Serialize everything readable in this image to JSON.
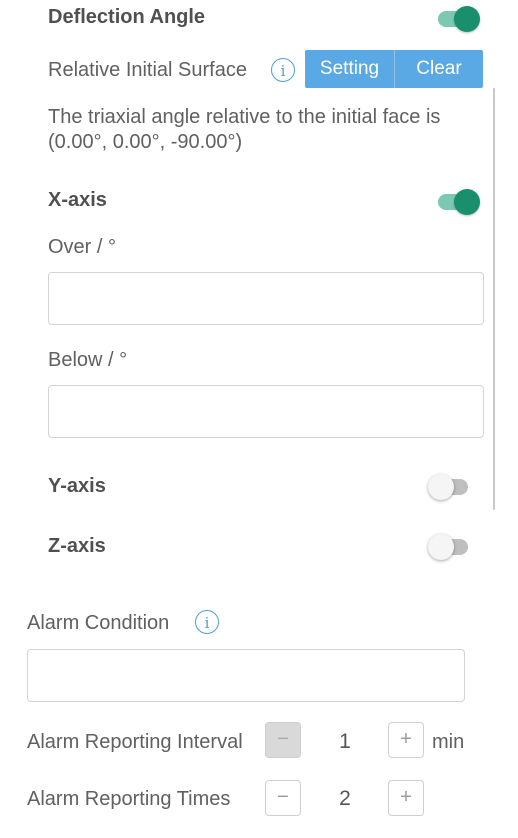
{
  "deflection": {
    "title": "Deflection Angle",
    "enabled": true,
    "relative_label": "Relative Initial Surface",
    "info_icon": "info-icon",
    "buttons": [
      "Setting",
      "Clear"
    ],
    "description": "The triaxial angle relative to the initial face is (0.00°, 0.00°, -90.00°)"
  },
  "x_axis": {
    "label": "X-axis",
    "enabled": true,
    "over_label": "Over / °",
    "over_value": "",
    "below_label": "Below / °",
    "below_value": ""
  },
  "y_axis": {
    "label": "Y-axis",
    "enabled": false
  },
  "z_axis": {
    "label": "Z-axis",
    "enabled": false
  },
  "alarm_condition": {
    "label": "Alarm Condition",
    "info_icon": "info-icon",
    "value": ""
  },
  "alarm_interval": {
    "label": "Alarm Reporting Interval",
    "minus": "−",
    "plus": "+",
    "value": "1",
    "unit": "min"
  },
  "alarm_times": {
    "label": "Alarm Reporting Times",
    "minus": "−",
    "plus": "+",
    "value": "2"
  },
  "colors": {
    "accent": "#5aa8e4",
    "toggle_on": "#1a8f6e",
    "toggle_on_track": "#7cc9b3"
  }
}
